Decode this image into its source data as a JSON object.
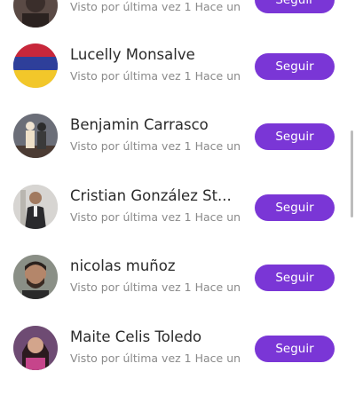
{
  "follow_label": "Seguir",
  "accent_color": "#7a36d6",
  "users": [
    {
      "name": "",
      "last_seen": "Visto por última vez 1 Hace un ...",
      "avatar": "dark-portrait"
    },
    {
      "name": "Lucelly Monsalve",
      "last_seen": "Visto por última vez 1 Hace un ...",
      "avatar": "colombia-flag"
    },
    {
      "name": "Benjamin Carrasco",
      "last_seen": "Visto por última vez 1 Hace un ...",
      "avatar": "costume-figures"
    },
    {
      "name": "Cristian González St...",
      "last_seen": "Visto por última vez 1 Hace un ...",
      "avatar": "man-in-suit"
    },
    {
      "name": "nicolas muñoz",
      "last_seen": "Visto por última vez 1 Hace un ...",
      "avatar": "bearded-man"
    },
    {
      "name": "Maite Celis Toledo",
      "last_seen": "Visto por última vez 1 Hace un ...",
      "avatar": "woman-pink"
    }
  ]
}
